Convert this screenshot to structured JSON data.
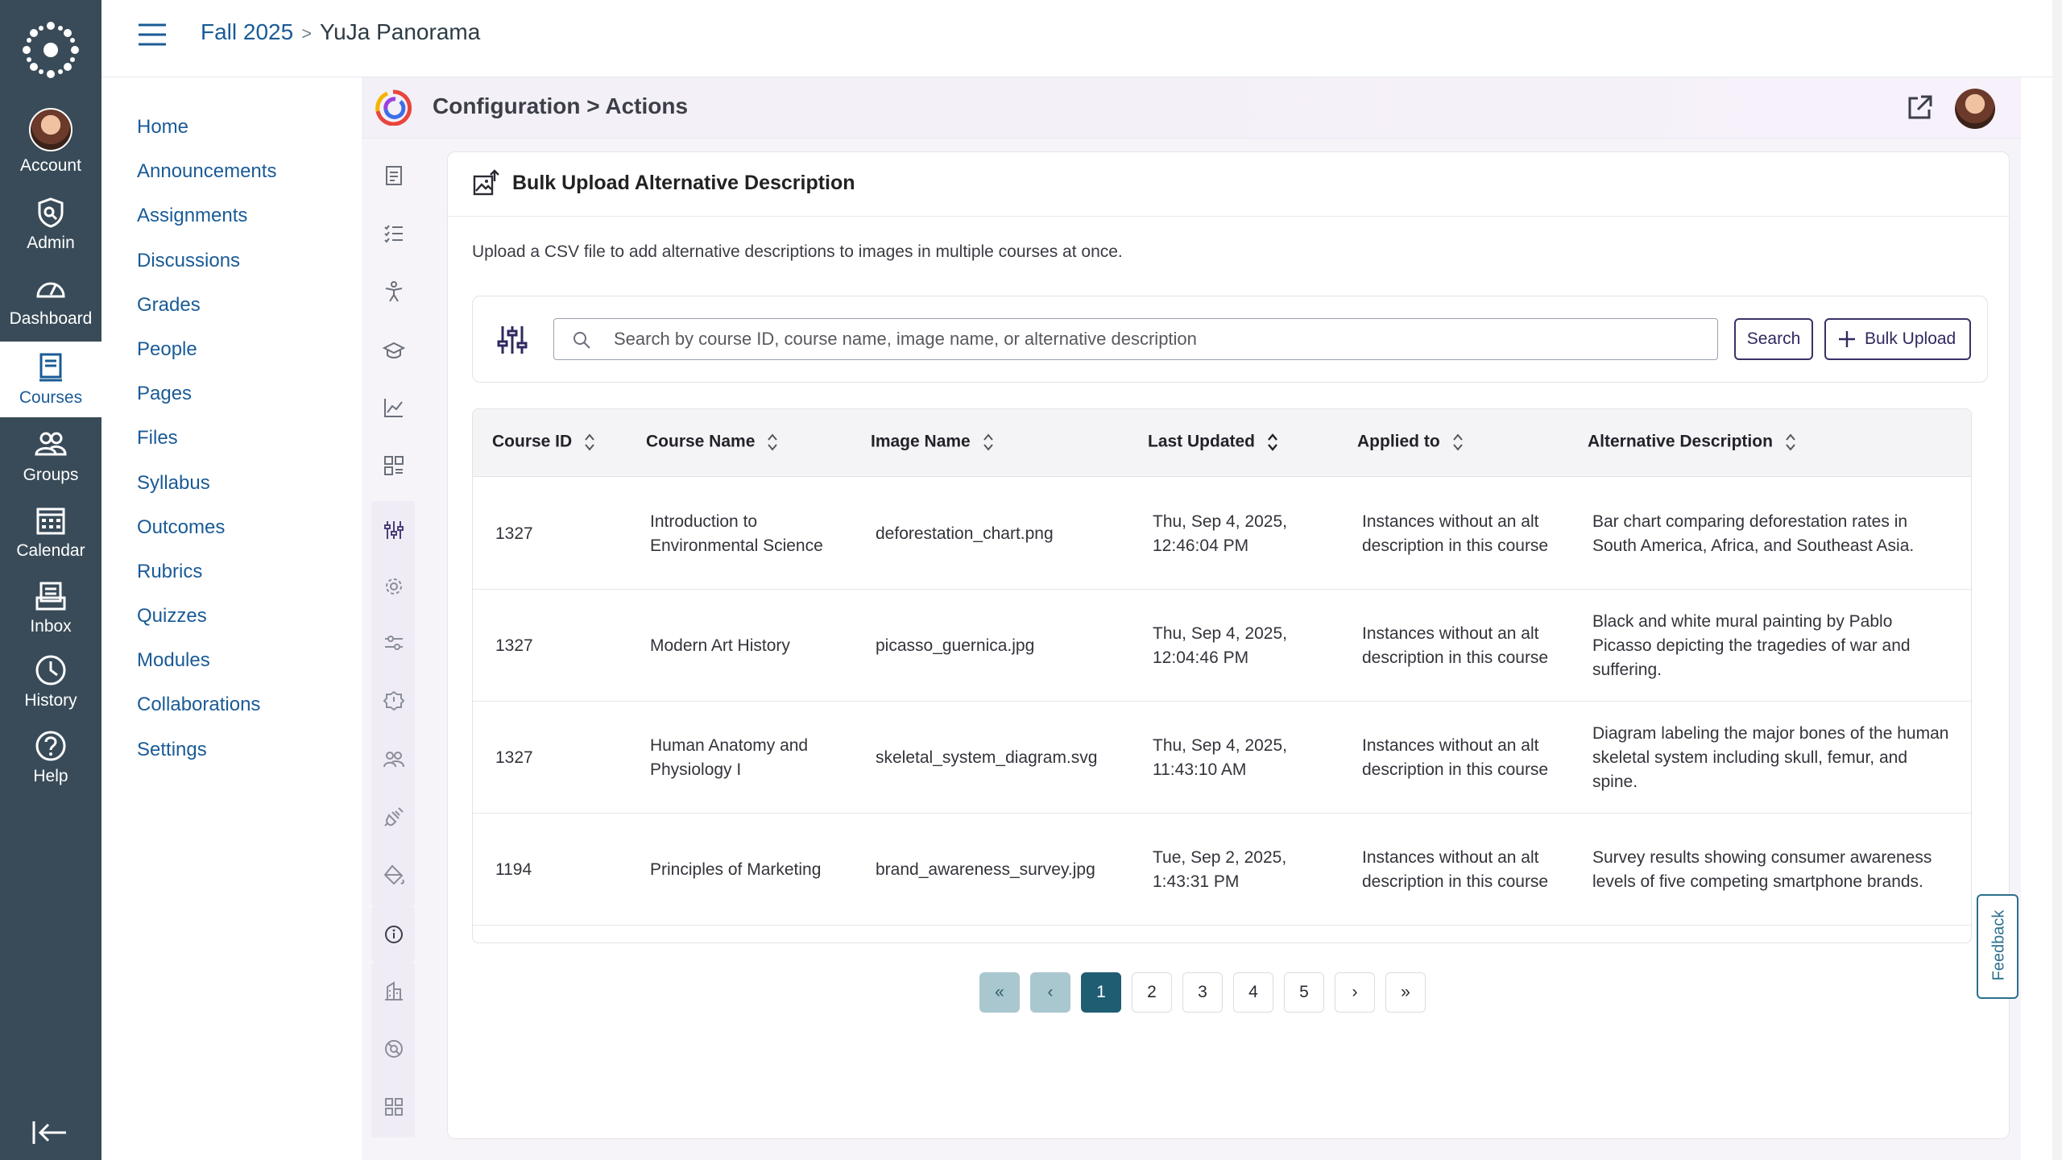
{
  "global_nav": {
    "items": [
      {
        "label": "Account",
        "icon": "avatar"
      },
      {
        "label": "Admin",
        "icon": "shield-icon"
      },
      {
        "label": "Dashboard",
        "icon": "dashboard-icon"
      },
      {
        "label": "Courses",
        "icon": "courses-icon"
      },
      {
        "label": "Groups",
        "icon": "groups-icon"
      },
      {
        "label": "Calendar",
        "icon": "calendar-icon"
      },
      {
        "label": "Inbox",
        "icon": "inbox-icon"
      },
      {
        "label": "History",
        "icon": "clock-icon"
      },
      {
        "label": "Help",
        "icon": "help-icon"
      }
    ],
    "active": "Courses"
  },
  "breadcrumb": {
    "course": "Fall 2025",
    "separator": ">",
    "page": "YuJa Panorama"
  },
  "course_nav": [
    "Home",
    "Announcements",
    "Assignments",
    "Discussions",
    "Grades",
    "People",
    "Pages",
    "Files",
    "Syllabus",
    "Outcomes",
    "Rubrics",
    "Quizzes",
    "Modules",
    "Collaborations",
    "Settings"
  ],
  "tool": {
    "title": "Configuration > Actions",
    "panel_title": "Bulk Upload Alternative Description",
    "description": "Upload a CSV file to add alternative descriptions to images in multiple courses at once.",
    "search": {
      "placeholder": "Search by course ID, course name, image name, or alternative description",
      "value": "",
      "search_label": "Search",
      "bulk_label": "Bulk Upload"
    },
    "columns": [
      "Course ID",
      "Course Name",
      "Image Name",
      "Last Updated",
      "Applied to",
      "Alternative Description"
    ],
    "rows": [
      {
        "course_id": "1327",
        "course_name": "Introduction to Environmental Science",
        "image_name": "deforestation_chart.png",
        "last_updated": "Thu, Sep 4, 2025, 12:46:04 PM",
        "applied_to": "Instances without an alt description in this course",
        "alt": "Bar chart comparing deforestation rates in South America, Africa, and Southeast Asia."
      },
      {
        "course_id": "1327",
        "course_name": "Modern Art History",
        "image_name": "picasso_guernica.jpg",
        "last_updated": "Thu, Sep 4, 2025, 12:04:46 PM",
        "applied_to": "Instances without an alt description in this course",
        "alt": "Black and white mural painting by Pablo Picasso depicting the tragedies of war and suffering."
      },
      {
        "course_id": "1327",
        "course_name": "Human Anatomy and Physiology I",
        "image_name": "skeletal_system_diagram.svg",
        "last_updated": "Thu, Sep 4, 2025, 11:43:10 AM",
        "applied_to": "Instances without an alt description in this course",
        "alt": "Diagram labeling the major bones of the human skeletal system including skull, femur, and spine."
      },
      {
        "course_id": "1194",
        "course_name": "Principles of Marketing",
        "image_name": "brand_awareness_survey.jpg",
        "last_updated": "Tue, Sep 2, 2025, 1:43:31 PM",
        "applied_to": "Instances without an alt description in this course",
        "alt": "Survey results showing consumer awareness levels of five competing smartphone brands."
      }
    ],
    "pagination": {
      "first": "«",
      "prev": "‹",
      "pages": [
        "1",
        "2",
        "3",
        "4",
        "5"
      ],
      "current": "1",
      "next": "›",
      "last": "»"
    },
    "feedback_label": "Feedback"
  },
  "colors": {
    "nav_bg": "#394b58",
    "link": "#1a5b96",
    "accent": "#1f5d73",
    "button_border": "#3b3168"
  }
}
